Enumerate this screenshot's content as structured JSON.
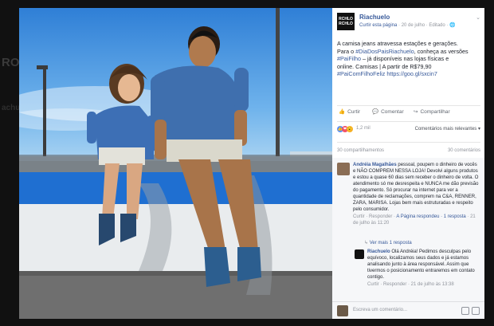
{
  "background": {
    "ghost_text": "RO",
    "ghost_text_2": "achu"
  },
  "post": {
    "page_name": "Riachuelo",
    "logo_text": [
      "RCHLO",
      "RCHLO"
    ],
    "meta_link": "Curtir esta página",
    "meta_date": " · 20 de julho · Editado · ",
    "text_line1": "A camisa jeans atravessa estações e gerações.",
    "text_line2_pre": "Para o ",
    "text_tag1": "#DiaDosPaisRiachuelo",
    "text_line2_post": ", conheça as versões",
    "text_tag2": "#PaiFilho",
    "text_line3": " – já disponíveis nas lojas físicas e",
    "text_line4": "online. Camisas | A partir de R$79,90",
    "text_tag3": "#PaiComFilhoFeliz",
    "text_link": " https://goo.gl/sxcin7"
  },
  "actions": {
    "like": "Curtir",
    "comment": "Comentar",
    "share": "Compartilhar"
  },
  "reactions": {
    "count": "1,2 mil",
    "sort_label": "Comentários mais relevantes ▾"
  },
  "counts": {
    "shares": "30 compartilhamentos",
    "comments": "30 comentários"
  },
  "comments": [
    {
      "author": "Andréia Magalhães",
      "text": "pessoal, poupem o dinheiro de vocês e NÃO COMPREM NESSA LOJA! Devolvi alguns produtos e estou a quase 60 dias sem receber o dinheiro de volta. O atendimento só me desrespeita e NUNCA me dão previsão do pagamento. Só procurar na internet para ver a quantidade de reclamações, comprem na C&A, RENNER, ZARA, MARISA. Lojas bem mais estruturadas e respeito pelo consumidor.",
      "footer_pre": "Curtir · Responder · ",
      "footer_link": "A Página respondeu · 1 resposta",
      "footer_post": " · 21 de julho às 11:20"
    },
    {
      "author": "Riachuelo",
      "see_reply": "Ver mais 1 resposta",
      "text": "Olá Andréia! Pedimos desculpas pelo equívoco, localizamos seus dados e já estamos analisando junto à área responsável. Assim que tivermos o posicionamento entraremos em contato contigo.",
      "footer": "Curtir · Responder · 21 de julho às 13:38"
    }
  ],
  "composer": {
    "placeholder": "Escreva um comentário..."
  }
}
